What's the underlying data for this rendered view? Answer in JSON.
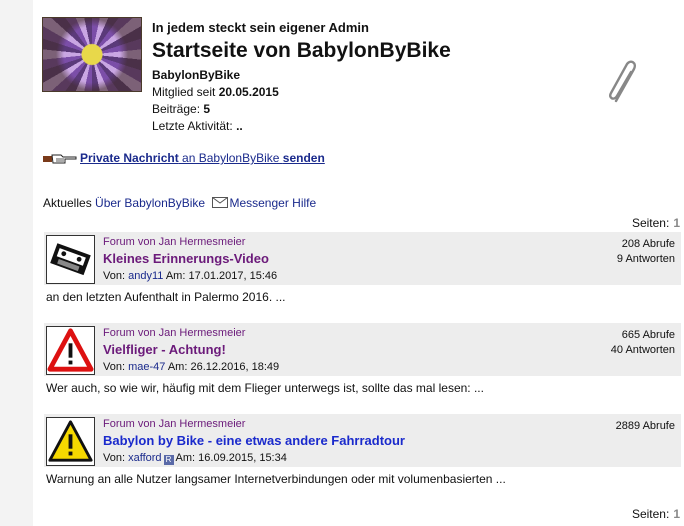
{
  "profile": {
    "tagline": "In jedem steckt sein eigener Admin",
    "title": "Startseite von BabylonByBike",
    "username": "BabylonByBike",
    "member_label": "Mitglied seit",
    "member_since": "20.05.2015",
    "posts_label": "Beiträge:",
    "posts": "5",
    "last_activity_label": "Letzte Aktivität:",
    "last_activity": ".."
  },
  "pm": {
    "part1": "Private Nachricht",
    "part2": " an BabylonByBike ",
    "part3": "senden"
  },
  "nav": {
    "current": "Aktuelles",
    "about": "Über BabylonByBike",
    "messenger": "Messenger Hilfe"
  },
  "pagination": {
    "label": "Seiten:",
    "value": "1"
  },
  "posts": [
    {
      "forum": "Forum von Jan Hermesmeier",
      "title": "Kleines Erinnerungs-Video",
      "by_label": "Von:",
      "author": "andy11",
      "date_label": "Am:",
      "date": "17.01.2017, 15:46",
      "views": "208 Abrufe",
      "replies": "9 Antworten",
      "excerpt": "an den letzten Aufenthalt in Palermo 2016. ...",
      "icon": "video-cassette-icon"
    },
    {
      "forum": "Forum von Jan Hermesmeier",
      "title": "Vielfliger - Achtung!",
      "by_label": "Von:",
      "author": "mae-47",
      "date_label": "Am:",
      "date": "26.12.2016, 18:49",
      "views": "665 Abrufe",
      "replies": "40 Antworten",
      "excerpt": "Wer auch, so wie wir, häufig mit dem Flieger unterwegs ist, sollte das mal lesen: ...",
      "icon": "warning-red-icon"
    },
    {
      "forum": "Forum von Jan Hermesmeier",
      "title": "Babylon by Bike - eine etwas andere Fahrradtour",
      "by_label": "Von:",
      "author": "xafford",
      "badge": "R",
      "date_label": "Am:",
      "date": "16.09.2015, 15:34",
      "views": "2889 Abrufe",
      "excerpt": "Warnung an alle Nutzer langsamer Internetverbindungen oder mit volumenbasierten ...",
      "icon": "warning-yellow-icon"
    }
  ],
  "colors": {
    "link": "#1a2a8c",
    "visited": "#6b1a7a",
    "band": "#ededed"
  }
}
